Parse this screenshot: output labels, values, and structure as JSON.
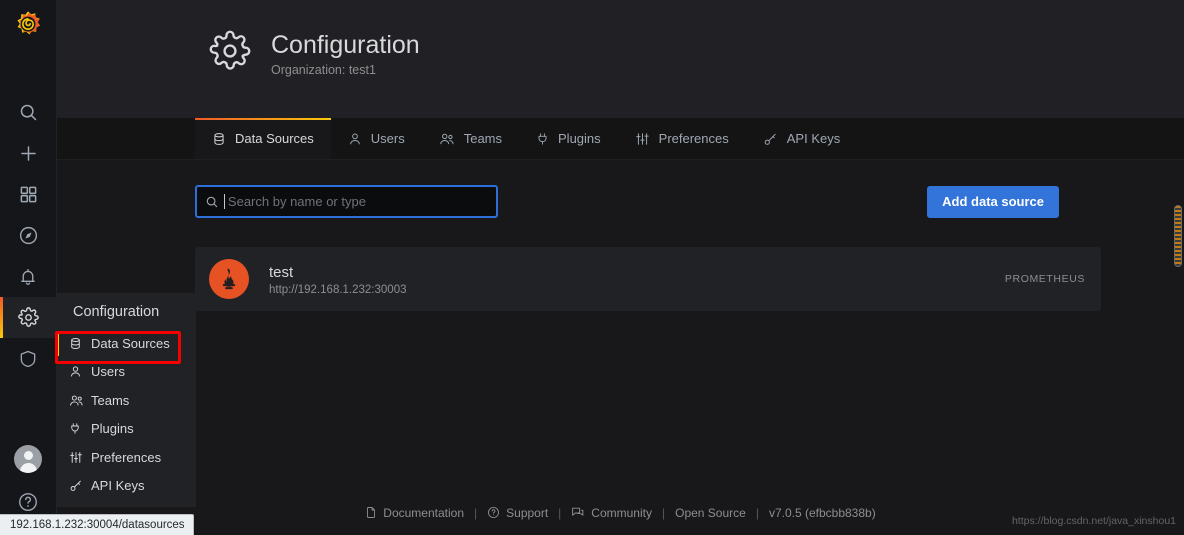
{
  "brand": {
    "logo_icon": "grafana-logo-icon",
    "logo_colors": [
      "#f05a28",
      "#fbca0a"
    ]
  },
  "navrail": {
    "items": [
      {
        "icon": "search-icon",
        "name": "search"
      },
      {
        "icon": "plus-icon",
        "name": "create"
      },
      {
        "icon": "dashboards-icon",
        "name": "dashboards"
      },
      {
        "icon": "compass-icon",
        "name": "explore"
      },
      {
        "icon": "bell-icon",
        "name": "alerting"
      },
      {
        "icon": "gear-icon",
        "name": "configuration",
        "active": true
      },
      {
        "icon": "shield-icon",
        "name": "server-admin"
      }
    ],
    "bottom": [
      {
        "icon": "avatar-icon",
        "name": "user-profile"
      },
      {
        "icon": "question-circle-icon",
        "name": "help"
      }
    ]
  },
  "flyout": {
    "title": "Configuration",
    "items": [
      {
        "label": "Data Sources",
        "icon": "database-icon",
        "active": true
      },
      {
        "label": "Users",
        "icon": "user-icon",
        "active": false
      },
      {
        "label": "Teams",
        "icon": "users-icon",
        "active": false
      },
      {
        "label": "Plugins",
        "icon": "plug-icon",
        "active": false
      },
      {
        "label": "Preferences",
        "icon": "sliders-icon",
        "active": false
      },
      {
        "label": "API Keys",
        "icon": "key-icon",
        "active": false
      }
    ],
    "annotation_color": "#f50000"
  },
  "header": {
    "icon": "gear-icon",
    "title": "Configuration",
    "subtitle": "Organization: test1"
  },
  "tabs": [
    {
      "label": "Data Sources",
      "icon": "database-icon",
      "active": true
    },
    {
      "label": "Users",
      "icon": "user-icon",
      "active": false
    },
    {
      "label": "Teams",
      "icon": "users-icon",
      "active": false
    },
    {
      "label": "Plugins",
      "icon": "plug-icon",
      "active": false
    },
    {
      "label": "Preferences",
      "icon": "sliders-icon",
      "active": false
    },
    {
      "label": "API Keys",
      "icon": "key-icon",
      "active": false
    }
  ],
  "toolbar": {
    "search": {
      "icon": "search-icon",
      "placeholder": "Search by name or type",
      "value": "",
      "focused": true,
      "focus_color": "#2d6ed8"
    },
    "add_button": {
      "label": "Add data source",
      "color": "#3274d9"
    }
  },
  "datasources": [
    {
      "name": "test",
      "url": "http://192.168.1.232:30003",
      "type": "PROMETHEUS",
      "logo_icon": "prometheus-icon",
      "logo_color": "#e75225"
    }
  ],
  "footer": {
    "links": [
      {
        "label": "Documentation",
        "icon": "file-icon"
      },
      {
        "label": "Support",
        "icon": "question-circle-icon"
      },
      {
        "label": "Community",
        "icon": "comments-icon"
      },
      {
        "label": "Open Source",
        "icon": ""
      }
    ],
    "separator": "|",
    "version": "v7.0.5 (efbcbb838b)"
  },
  "statusbar": {
    "url": "192.168.1.232:30004/datasources"
  },
  "watermark": {
    "text": "https://blog.csdn.net/java_xinshou1"
  }
}
